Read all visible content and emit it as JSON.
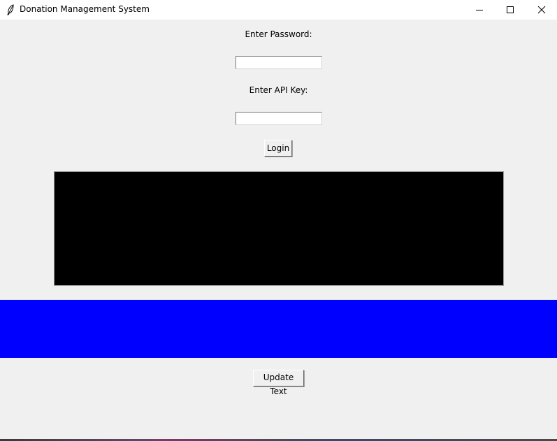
{
  "window": {
    "title": "Donation Management System",
    "controls": {
      "minimize_icon": "minimize-icon",
      "maximize_icon": "maximize-icon",
      "close_icon": "close-icon"
    },
    "app_icon": "feather-icon"
  },
  "form": {
    "password_label": "Enter Password:",
    "password_value": "",
    "api_key_label": "Enter API Key:",
    "api_key_value": "",
    "login_button": "Login"
  },
  "canvas": {
    "background": "#000000"
  },
  "banner": {
    "background": "#0000ff",
    "text": ""
  },
  "actions": {
    "update_button": "Update Text"
  },
  "colors": {
    "window_bg": "#f0f0f0",
    "titlebar_bg": "#ffffff"
  }
}
